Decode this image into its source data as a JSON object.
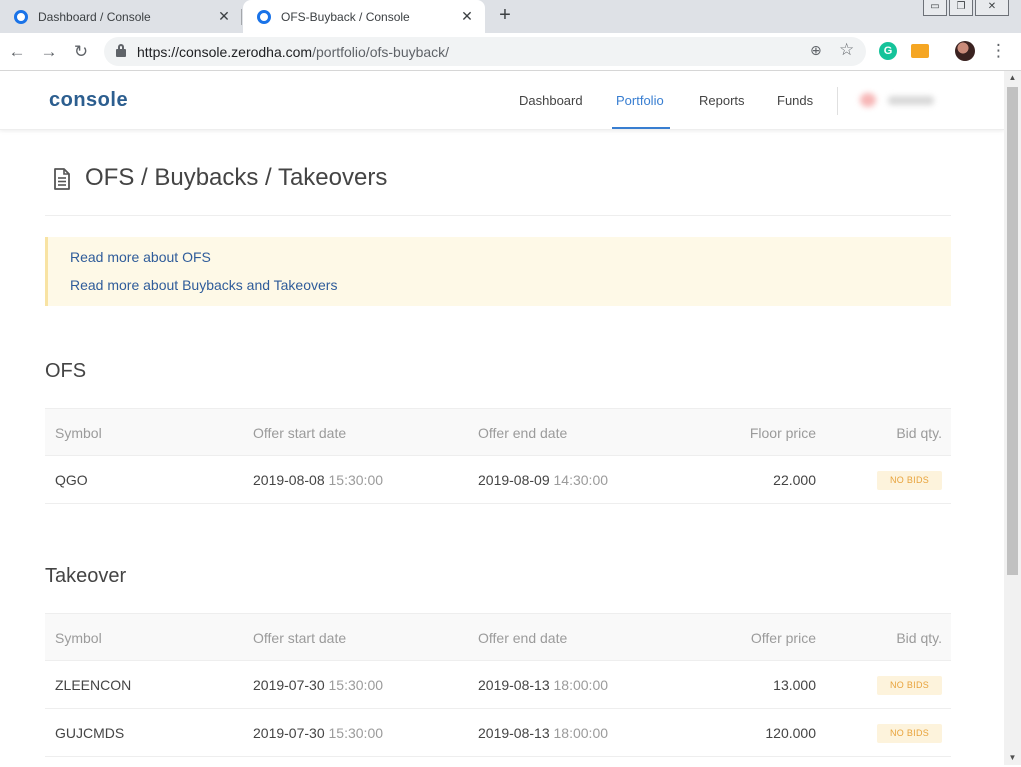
{
  "browser": {
    "tabs": [
      {
        "title": "Dashboard / Console",
        "active": false,
        "close": "✕"
      },
      {
        "title": "OFS-Buyback / Console",
        "active": true,
        "close": "✕"
      }
    ],
    "new_tab": "+",
    "url_host": "https://console.zerodha.com",
    "url_path": "/portfolio/ofs-buyback/",
    "icons": {
      "back": "arrow-left",
      "forward": "arrow-right",
      "reload": "reload",
      "zoom": "zoom",
      "star": "star",
      "grammarly": "grammarly",
      "menu": "three-dots"
    },
    "grammarly_letter": "G"
  },
  "header": {
    "logo": "console",
    "nav": [
      {
        "label": "Dashboard",
        "active": false
      },
      {
        "label": "Portfolio",
        "active": true
      },
      {
        "label": "Reports",
        "active": false
      },
      {
        "label": "Funds",
        "active": false
      }
    ]
  },
  "page": {
    "title": "OFS / Buybacks / Takeovers",
    "notice_links": [
      "Read more about OFS",
      "Read more about Buybacks and Takeovers"
    ]
  },
  "ofs": {
    "title": "OFS",
    "columns": [
      "Symbol",
      "Offer start date",
      "Offer end date",
      "Floor price",
      "Bid qty."
    ],
    "rows": [
      {
        "symbol": "QGO",
        "start_date": "2019-08-08",
        "start_time": "15:30:00",
        "end_date": "2019-08-09",
        "end_time": "14:30:00",
        "price": "22.000",
        "bid": "NO BIDS"
      }
    ]
  },
  "takeover": {
    "title": "Takeover",
    "columns": [
      "Symbol",
      "Offer start date",
      "Offer end date",
      "Offer price",
      "Bid qty."
    ],
    "rows": [
      {
        "symbol": "ZLEENCON",
        "start_date": "2019-07-30",
        "start_time": "15:30:00",
        "end_date": "2019-08-13",
        "end_time": "18:00:00",
        "price": "13.000",
        "bid": "NO BIDS"
      },
      {
        "symbol": "GUJCMDS",
        "start_date": "2019-07-30",
        "start_time": "15:30:00",
        "end_date": "2019-08-13",
        "end_time": "18:00:00",
        "price": "120.000",
        "bid": "NO BIDS"
      }
    ]
  },
  "colors": {
    "accent": "#387ed1",
    "logo": "#2c5e8f",
    "notice_bg": "#fef9e7",
    "badge_text": "#e8a33c"
  }
}
